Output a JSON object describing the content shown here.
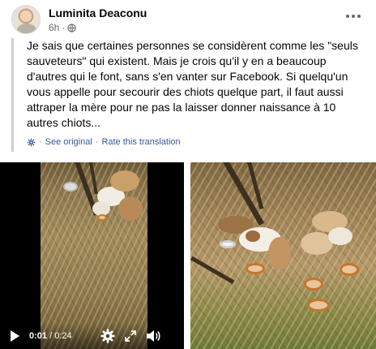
{
  "post": {
    "author": "Luminita Deaconu",
    "time": "6h",
    "time_separator": "·",
    "more_icon": "more-horizontal-icon"
  },
  "quote": {
    "text": "Je sais que certaines personnes se considèrent comme les \"seuls sauveteurs\" qui existent. Mais je crois qu'il y en a beaucoup d'autres qui le font, sans s'en vanter sur Facebook. Si quelqu'un vous appelle pour secourir des chiots quelque part, il faut aussi attraper la mère pour ne pas la laisser donner naissance à 10 autres chiots...",
    "see_original": "See original",
    "separator": "·",
    "rate_translation": "Rate this translation"
  },
  "video": {
    "current_time": "0:01",
    "time_divider": " / ",
    "duration": "0:24",
    "icons": [
      "play-icon",
      "settings-gear-icon",
      "fullscreen-icon",
      "volume-icon"
    ]
  },
  "colors": {
    "link": "#385898",
    "meta": "#65676b",
    "quote_border": "#ccd0d5"
  }
}
